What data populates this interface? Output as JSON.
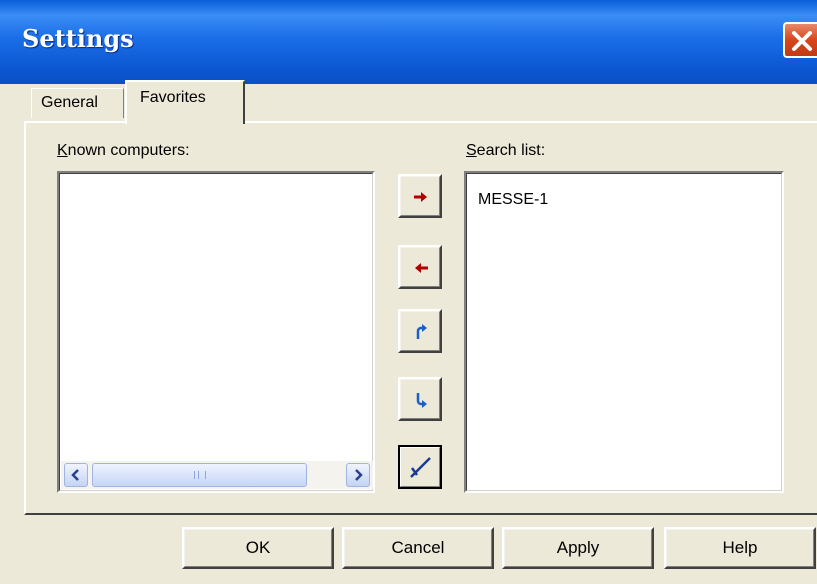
{
  "window": {
    "title": "Settings"
  },
  "tabs": [
    {
      "label": "General",
      "active": false
    },
    {
      "label": "Favorites",
      "active": true
    }
  ],
  "known_computers": {
    "label_access_key": "K",
    "label_rest": "nown computers:",
    "items": []
  },
  "search_list": {
    "label_access_key": "S",
    "label_rest": "earch list:",
    "items": [
      "MESSE-1"
    ]
  },
  "move_buttons": [
    {
      "icon": "arrow-right-icon",
      "color": "#b00000"
    },
    {
      "icon": "arrow-left-icon",
      "color": "#b00000"
    },
    {
      "icon": "move-up-icon",
      "color": "#1a5ec8"
    },
    {
      "icon": "move-down-icon",
      "color": "#1a5ec8"
    },
    {
      "icon": "clear-checkmark-icon",
      "color": "#1a3a9a"
    }
  ],
  "buttons": {
    "ok": "OK",
    "cancel": "Cancel",
    "apply": "Apply",
    "help": "Help"
  },
  "colors": {
    "title_bar": "#0a5fd8",
    "face": "#ece9d8",
    "close": "#d6461c"
  }
}
